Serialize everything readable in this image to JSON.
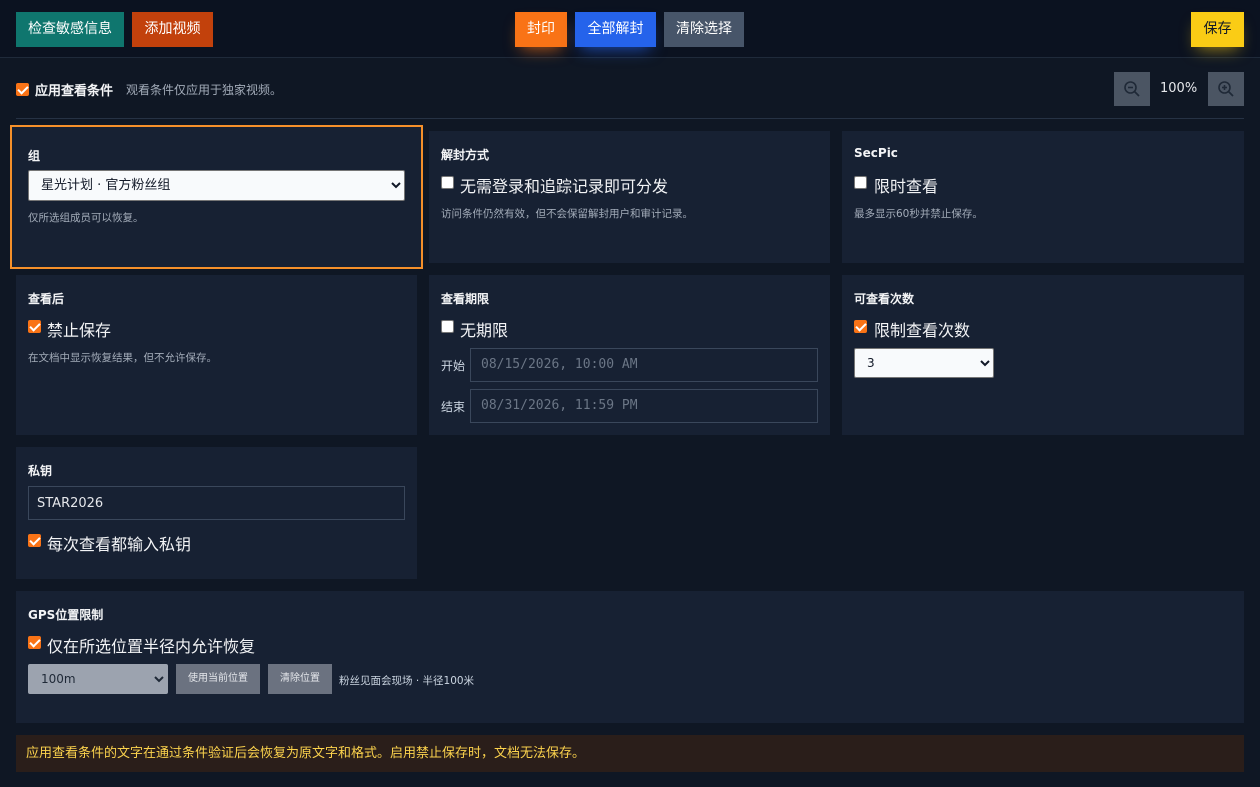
{
  "toolbar": {
    "check_label": "检查敏感信息",
    "add_video_label": "添加视频",
    "seal_label": "封印",
    "unseal_all_label": "全部解封",
    "clear_selection_label": "清除选择",
    "save_label": "保存"
  },
  "conditions": {
    "apply_label": "应用查看条件",
    "apply_checked": true,
    "apply_hint": "观看条件仅应用于独家视频。",
    "zoom": "100%"
  },
  "group": {
    "title": "组",
    "selected": "星光计划 · 官方粉丝组",
    "hint": "仅所选组成员可以恢复。"
  },
  "unseal_method": {
    "title": "解封方式",
    "option_label": "无需登录和追踪记录即可分发",
    "option_checked": false,
    "hint": "访问条件仍然有效，但不会保留解封用户和审计记录。"
  },
  "secpic": {
    "title": "SecPic",
    "option_label": "限时查看",
    "option_checked": false,
    "hint": "最多显示60秒并禁止保存。"
  },
  "after_view": {
    "title": "查看后",
    "option_label": "禁止保存",
    "option_checked": true,
    "hint": "在文档中显示恢复结果，但不允许保存。"
  },
  "period": {
    "title": "查看期限",
    "option_label": "无期限",
    "option_checked": false,
    "start_label": "开始",
    "start_value": "08/15/2026, 10:00 AM",
    "end_label": "结束",
    "end_value": "08/31/2026, 11:59 PM"
  },
  "view_count": {
    "title": "可查看次数",
    "option_label": "限制查看次数",
    "option_checked": true,
    "selected": "3"
  },
  "private_key": {
    "title": "私钥",
    "value": "STAR2026",
    "option_label": "每次查看都输入私钥",
    "option_checked": true
  },
  "gps": {
    "title": "GPS位置限制",
    "option_label": "仅在所选位置半径内允许恢复",
    "option_checked": true,
    "radius_selected": "100m",
    "use_current_label": "使用当前位置",
    "clear_label": "清除位置",
    "location_text": "粉丝见面会现场 · 半径100米"
  },
  "notice": "应用查看条件的文字在通过条件验证后会恢复为原文字和格式。启用禁止保存时，文档无法保存。",
  "colors": {
    "background": "#0f1724",
    "card": "#172133",
    "accent_orange": "#f97316",
    "check_teal": "#0f766e",
    "add_red": "#c2410c",
    "unseal_blue": "#2563eb",
    "clear_gray": "#475569",
    "save_yellow": "#facc15",
    "focus_border": "#f5902a",
    "notice_text": "#fcd34d"
  },
  "icons": {
    "zoom_out": "zoom-out-icon",
    "zoom_in": "zoom-in-icon"
  }
}
